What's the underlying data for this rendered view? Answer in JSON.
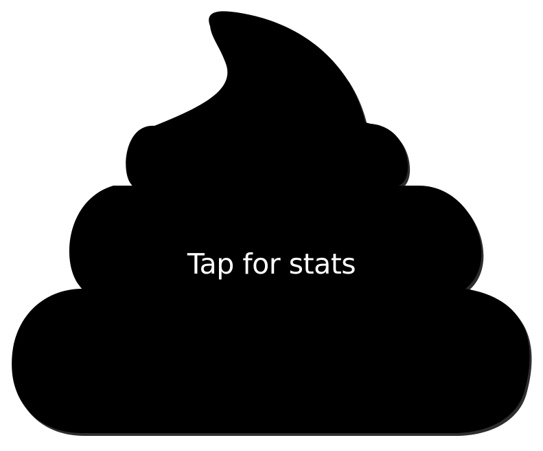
{
  "poop_button": {
    "label": "Tap for stats",
    "icon": "poop-icon",
    "fill_color": "#000000",
    "shadow_color": "#2e2e2e",
    "label_color": "#ffffff"
  }
}
